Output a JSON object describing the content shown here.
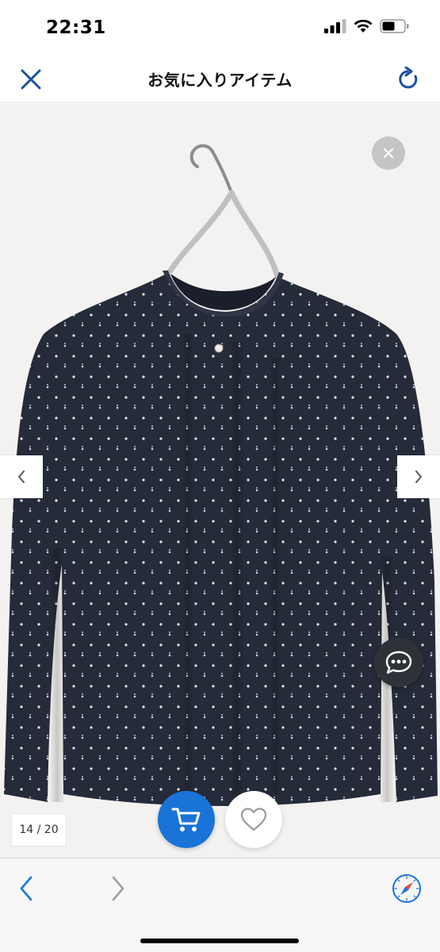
{
  "status_bar": {
    "time": "22:31"
  },
  "header": {
    "title": "お気に入りアイテム",
    "close_icon": "close-icon",
    "reload_icon": "reload-icon"
  },
  "product": {
    "image_description_icon": "blouse-photo",
    "counter": "14 / 20"
  },
  "colors": {
    "accent": "#1a73d9",
    "header_icons": "#1a4fa0",
    "garment": "#262b3a",
    "chat_button": "#2f3138",
    "dismiss_button": "#c5c5c7"
  },
  "toolbar": {
    "back_icon": "chevron-left-icon",
    "forward_icon": "chevron-right-icon",
    "safari_icon": "compass-icon"
  }
}
